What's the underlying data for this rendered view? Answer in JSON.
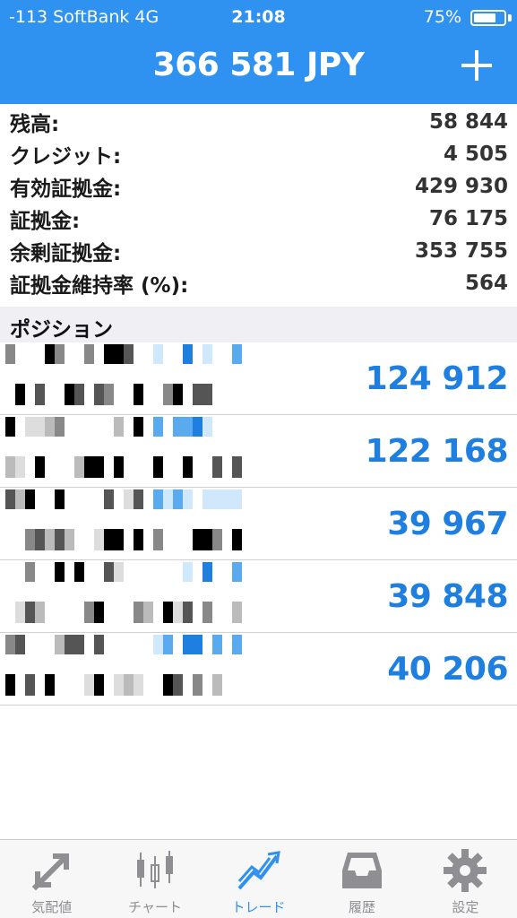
{
  "status_bar": {
    "carrier": "-113 SoftBank   4G",
    "time": "21:08",
    "battery_percent": "75%",
    "battery_level": 0.75
  },
  "header": {
    "title": "366 581 JPY",
    "add_icon": "plus-icon",
    "background_color": "#2f91f0"
  },
  "account": [
    {
      "label": "残高:",
      "value": "58 844"
    },
    {
      "label": "クレジット:",
      "value": "4 505"
    },
    {
      "label": "有効証拠金:",
      "value": "429 930"
    },
    {
      "label": "証拠金:",
      "value": "76 175"
    },
    {
      "label": "余剰証拠金:",
      "value": "353 755"
    },
    {
      "label": "証拠金維持率 (%):",
      "value": "564"
    }
  ],
  "positions_section": {
    "title": "ポジション"
  },
  "positions": [
    {
      "amount": "124 912"
    },
    {
      "amount": "122 168"
    },
    {
      "amount": "39 967"
    },
    {
      "amount": "39 848"
    },
    {
      "amount": "40 206"
    }
  ],
  "tabs": [
    {
      "label": "気配値",
      "icon": "quotes-arrows-icon",
      "active": false
    },
    {
      "label": "チャート",
      "icon": "candlestick-chart-icon",
      "active": false
    },
    {
      "label": "トレード",
      "icon": "trade-line-icon",
      "active": true
    },
    {
      "label": "履歴",
      "icon": "history-tray-icon",
      "active": false
    },
    {
      "label": "設定",
      "icon": "gear-icon",
      "active": false
    }
  ],
  "colors": {
    "accent": "#2f91f0",
    "amount": "#1e7fe0",
    "inactive_tab": "#8e8e93"
  }
}
